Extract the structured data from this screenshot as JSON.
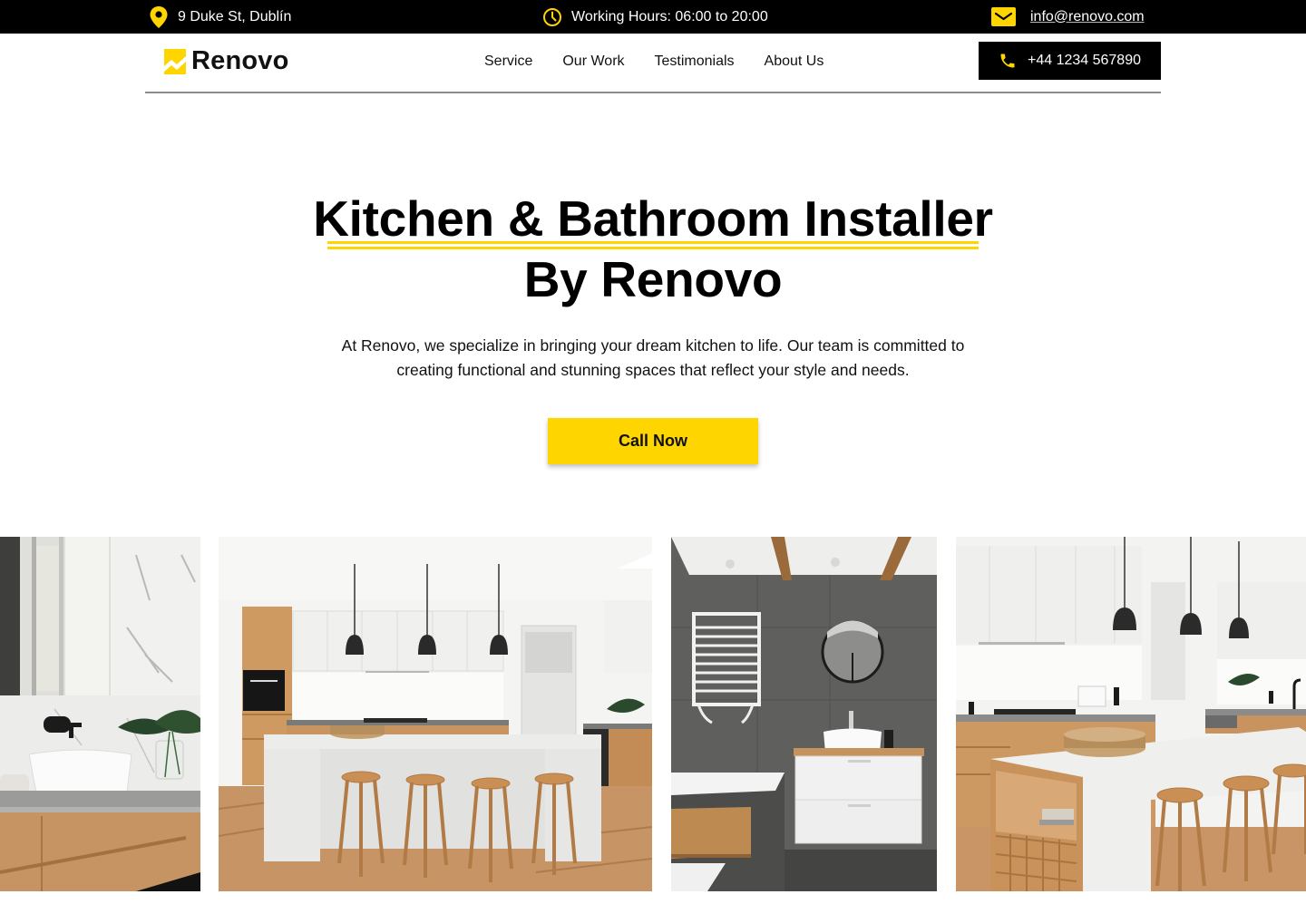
{
  "topbar": {
    "address": "9 Duke St, Dublín",
    "hours": "Working Hours: 06:00 to 20:00",
    "email": "info@renovo.com",
    "icons": {
      "address": "map-pin-icon",
      "hours": "clock-icon",
      "email": "envelope-icon"
    }
  },
  "header": {
    "logo_text": "Renovo",
    "nav": [
      {
        "label": "Service"
      },
      {
        "label": "Our Work"
      },
      {
        "label": "Testimonials"
      },
      {
        "label": "About Us"
      }
    ],
    "phone": "+44 1234 567890",
    "phone_icon": "phone-icon"
  },
  "hero": {
    "title_line1": "Kitchen & Bathroom Installer",
    "title_line2": "By Renovo",
    "description_line1": "At Renovo, we specialize in bringing your dream kitchen to life. Our team is committed to",
    "description_line2": "creating functional and stunning spaces that reflect your style and needs.",
    "cta_label": "Call Now"
  },
  "gallery": [
    {
      "alt": "Bathroom vanity with vessel sink, black tap and monstera plant"
    },
    {
      "alt": "White kitchen island with four wooden stools and black pendant lights"
    },
    {
      "alt": "Grey tiled bathroom with white towel radiator, round mirror and floating vanity"
    },
    {
      "alt": "Kitchen island with wine rack, wicker tray and wooden stools"
    }
  ],
  "colors": {
    "accent": "#ffd500",
    "topbar_bg": "#000000",
    "text": "#111111",
    "divider": "#8a8a8a"
  }
}
